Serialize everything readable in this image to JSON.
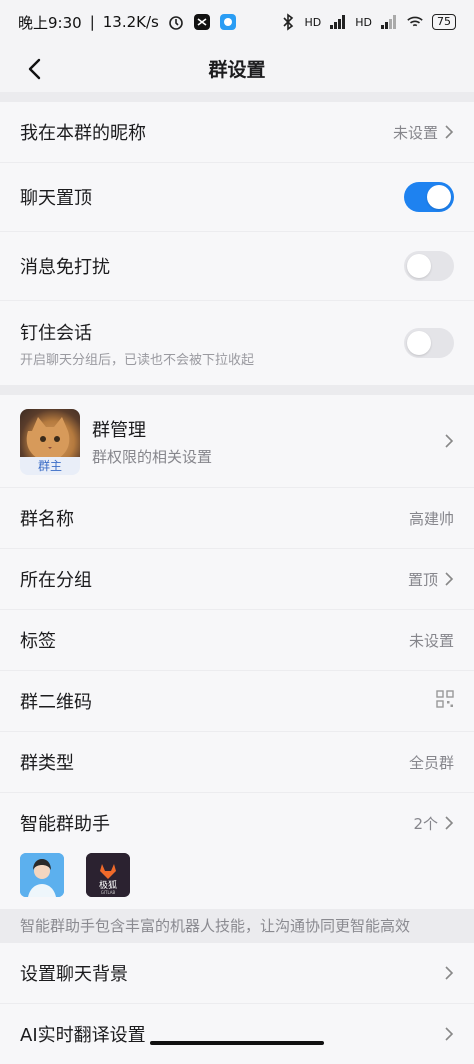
{
  "status": {
    "time": "晚上9:30",
    "speed": "13.2K/s",
    "battery": "75",
    "hd1": "HD",
    "hd2": "HD"
  },
  "header": {
    "title": "群设置"
  },
  "rows_top": {
    "nickname": {
      "label": "我在本群的昵称",
      "value": "未设置"
    },
    "pin_chat": {
      "label": "聊天置顶",
      "on": true
    },
    "dnd": {
      "label": "消息免打扰",
      "on": false
    },
    "pin_session": {
      "label": "钉住会话",
      "sub": "开启聊天分组后，已读也不会被下拉收起",
      "on": false
    }
  },
  "group_manage": {
    "title": "群管理",
    "sub": "群权限的相关设置",
    "badge": "群主"
  },
  "rows_info": {
    "name": {
      "label": "群名称",
      "value": "高建帅"
    },
    "group": {
      "label": "所在分组",
      "value": "置顶"
    },
    "tag": {
      "label": "标签",
      "value": "未设置"
    },
    "qrcode": {
      "label": "群二维码"
    },
    "type": {
      "label": "群类型",
      "value": "全员群"
    },
    "assistant": {
      "label": "智能群助手",
      "value": "2个"
    }
  },
  "assistant_icons": [
    {
      "name": "avatar-woman-icon"
    },
    {
      "name": "gitlab-fox-icon",
      "text": "极狐",
      "subtext": "GITLAB"
    }
  ],
  "assistant_note": "智能群助手包含丰富的机器人技能，让沟通协同更智能高效",
  "rows_bottom": {
    "background": {
      "label": "设置聊天背景"
    },
    "translate": {
      "label": "AI实时翻译设置"
    }
  },
  "colors": {
    "accent": "#1e82f0",
    "toggle_off": "#e4e4e8"
  }
}
